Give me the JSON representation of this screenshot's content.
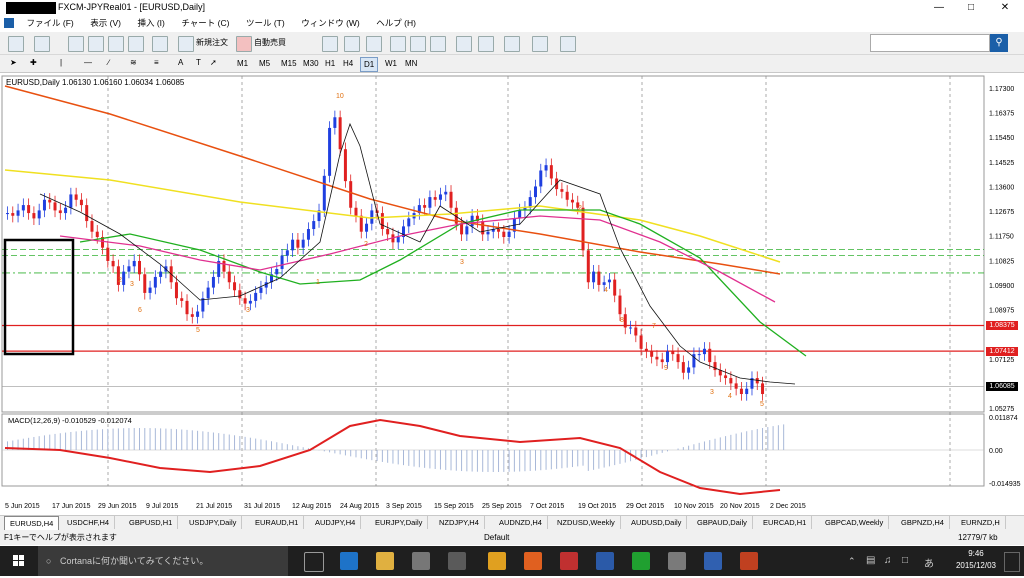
{
  "window": {
    "title": "FXCM-JPYReal01 - [EURUSD,Daily]",
    "minimize_glyph": "—",
    "restore_glyph": "□",
    "close_glyph": "✕"
  },
  "menu": {
    "items": [
      "ファイル (F)",
      "表示 (V)",
      "挿入 (I)",
      "チャート (C)",
      "ツール (T)",
      "ウィンドウ (W)",
      "ヘルプ (H)"
    ]
  },
  "toolbar": {
    "new_order": "新規注文",
    "auto_trade": "自動売買",
    "timeframes": [
      "M1",
      "M5",
      "M15",
      "M30",
      "H1",
      "H4",
      "D1",
      "W1",
      "MN"
    ],
    "active_timeframe": "D1",
    "search_icon": "search-icon"
  },
  "chart": {
    "header": "EURUSD,Daily  1.06130 1.06160 1.06034 1.06085",
    "macd_header": "MACD(12,26,9) -0.010529 -0.012074",
    "price_labels": [
      "1.17300",
      "1.16375",
      "1.15450",
      "1.14525",
      "1.13600",
      "1.12675",
      "1.11750",
      "1.10825",
      "1.09900",
      "1.08975",
      "1.07125",
      "1.05275"
    ],
    "marked_prices": [
      {
        "value": "1.08375",
        "color": "#e02020"
      },
      {
        "value": "1.07412",
        "color": "#e02020"
      },
      {
        "value": "1.06085",
        "color": "#000000"
      }
    ],
    "macd_labels": [
      "0.011874",
      "0.00",
      "-0.014935"
    ],
    "date_labels": [
      "5 Jun 2015",
      "17 Jun 2015",
      "29 Jun 2015",
      "9 Jul 2015",
      "21 Jul 2015",
      "31 Jul 2015",
      "12 Aug 2015",
      "24 Aug 2015",
      "3 Sep 2015",
      "15 Sep 2015",
      "25 Sep 2015",
      "7 Oct 2015",
      "19 Oct 2015",
      "29 Oct 2015",
      "10 Nov 2015",
      "20 Nov 2015",
      "2 Dec 2015"
    ]
  },
  "tabs": [
    "EURUSD,H4",
    "USDCHF,H4",
    "GBPUSD,H1",
    "USDJPY,Daily",
    "EURAUD,H1",
    "AUDJPY,H4",
    "EURJPY,Daily",
    "NZDJPY,H4",
    "AUDNZD,H4",
    "NZDUSD,Weekly",
    "AUDUSD,Daily",
    "GBPAUD,Daily",
    "EURCAD,H1",
    "GBPCAD,Weekly",
    "GBPNZD,H4",
    "EURNZD,H"
  ],
  "active_tab": "EURUSD,H4",
  "status": {
    "help": "F1キーでヘルプが表示されます",
    "profile": "Default",
    "traffic": "12779/7 kb"
  },
  "taskbar": {
    "cortana_placeholder": "Cortanaに何か聞いてみてください。",
    "time": "9:46",
    "date": "2015/12/03"
  },
  "colors": {
    "accent": "#1b5fa8",
    "bull": "#1f3fe0",
    "bear": "#e02020",
    "ma_orange": "#e85010",
    "ma_yellow": "#f0e020",
    "ma_green": "#20b020",
    "ma_magenta": "#e03090"
  }
}
